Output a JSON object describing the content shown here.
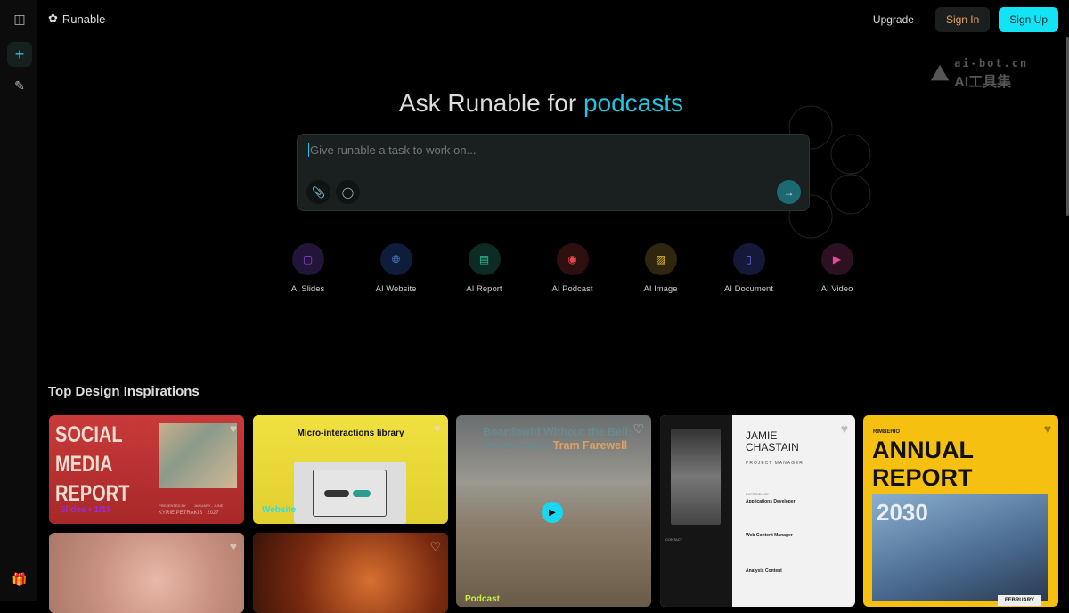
{
  "sidebar": {
    "items": [
      "toggle-sidebar",
      "new-task",
      "edit"
    ]
  },
  "header": {
    "brand": "Runable",
    "upgrade": "Upgrade",
    "sign_in": "Sign In",
    "sign_up": "Sign Up"
  },
  "watermark": {
    "line1": "ai-bot.cn",
    "line2": "AI工具集"
  },
  "hero": {
    "title_prefix": "Ask Runable for ",
    "title_accent": "podcasts",
    "placeholder": "Give runable a task to work on..."
  },
  "tools": [
    {
      "label": "AI Slides",
      "color": "#8a4fd6",
      "bg": "#23153a"
    },
    {
      "label": "AI Website",
      "color": "#4f8ee8",
      "bg": "#101d3a"
    },
    {
      "label": "AI Report",
      "color": "#2fbf8f",
      "bg": "#0d2a24"
    },
    {
      "label": "AI Podcast",
      "color": "#e84a4a",
      "bg": "#2d0f10"
    },
    {
      "label": "AI Image",
      "color": "#e8c030",
      "bg": "#2f2610"
    },
    {
      "label": "AI Document",
      "color": "#6a6ff0",
      "bg": "#151838"
    },
    {
      "label": "AI Video",
      "color": "#e84a9a",
      "bg": "#2d1022"
    }
  ],
  "inspirations": {
    "title": "Top Design Inspirations",
    "cards": [
      {
        "title_lines": [
          "SOCIAL",
          "MEDIA",
          "REPORT"
        ],
        "tag": "Slides • 1/19",
        "presenter": "KYRIE PETRAKIS",
        "year": "2027",
        "presented_by": "PRESENTED BY",
        "period": "JANUARY - JUNE"
      },
      {
        "title": "Micro-interactions library",
        "tag": "Website"
      },
      {
        "title1": "Boardowld Without the Bell:",
        "title2a": "Ocean City's ",
        "title2b": "Tram Farewell",
        "tag": "Podcast"
      },
      {
        "name_lines": [
          "JAMIE",
          "CHASTAIN"
        ],
        "role": "PROJECT MANAGER",
        "experience": "EXPERIENCE",
        "jobs": [
          "Applications Developer",
          "Web Content Manager",
          "Analysis Content"
        ],
        "contact": "CONTACT"
      },
      {
        "brand": "RIMBERIO",
        "title_lines": [
          "ANNUAL",
          "REPORT"
        ],
        "year": "2030",
        "month": "FEBRUARY"
      }
    ]
  }
}
